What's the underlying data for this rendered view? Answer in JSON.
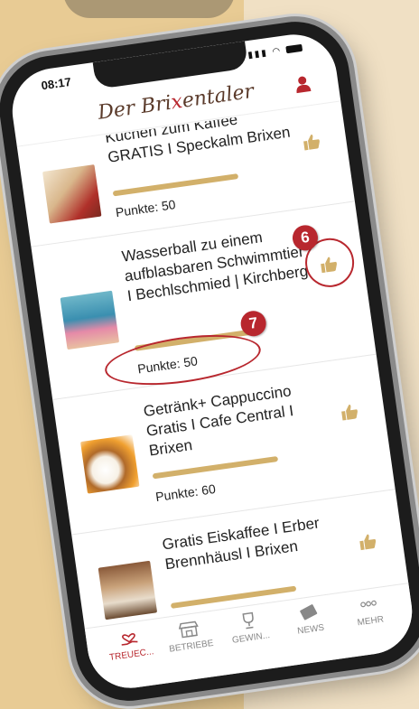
{
  "status": {
    "time": "08:17"
  },
  "header": {
    "logo_pre": "Der Bri",
    "logo_accent": "x",
    "logo_post": "entaler"
  },
  "items": [
    {
      "title": "Kuchen zum Kaffee GRATIS I Speckalm Brixen",
      "points": "Punkte: 50"
    },
    {
      "title": "Wasserball zu einem aufblasbaren Schwimmtier I Bechlschmied | Kirchberg",
      "points": "Punkte: 50"
    },
    {
      "title": "Getränk+ Cappuccino Gratis I Cafe Central I Brixen",
      "points": "Punkte: 60"
    },
    {
      "title": "Gratis Eiskaffee I Erber Brennhäusl I Brixen",
      "points": ""
    }
  ],
  "callouts": {
    "badge_6": "6",
    "badge_7": "7"
  },
  "tabs": [
    {
      "label": "TREUEC...",
      "icon": "hand-heart-icon"
    },
    {
      "label": "BETRIEBE",
      "icon": "store-icon"
    },
    {
      "label": "GEWIN...",
      "icon": "trophy-icon"
    },
    {
      "label": "NEWS",
      "icon": "newspaper-icon"
    },
    {
      "label": "MEHR",
      "icon": "more-icon"
    }
  ],
  "colors": {
    "accent": "#b8272e",
    "gold": "#d2b06a",
    "background": "#e8cb94"
  }
}
